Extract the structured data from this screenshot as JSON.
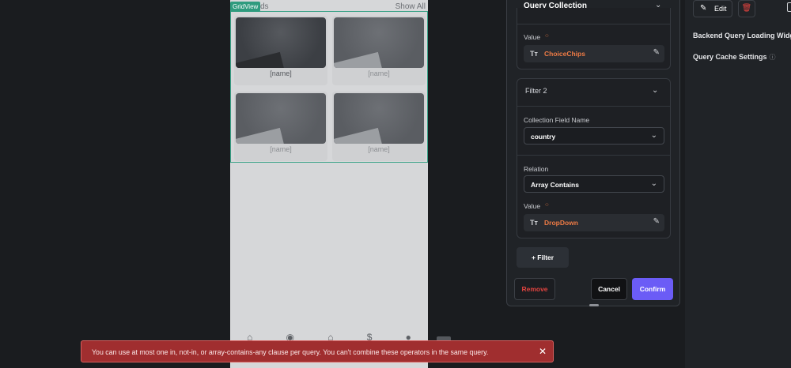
{
  "phone": {
    "title_partial": "ds",
    "show_all": "Show All",
    "gridview_badge": "GridView",
    "card_name": "[name]"
  },
  "query_panel": {
    "title": "Query Collection",
    "filter1": {
      "value_label": "Value",
      "value_text": "ChoiceChips"
    },
    "filter2": {
      "title": "Filter 2",
      "collection_field_label": "Collection Field Name",
      "collection_field_value": "country",
      "relation_label": "Relation",
      "relation_value": "Array Contains",
      "value_label": "Value",
      "value_text": "DropDown"
    },
    "add_filter_label": "Filter",
    "remove_label": "Remove",
    "cancel_label": "Cancel",
    "confirm_label": "Confirm"
  },
  "right_panel": {
    "edit_label": "Edit",
    "backend_query_loading": "Backend Query Loading Widge",
    "query_cache_settings": "Query Cache Settings"
  },
  "toast": {
    "message": "You can use at most one in, not-in, or array-contains-any clause per query. You can't combine these operators in the same query.",
    "close_symbol": "✕"
  },
  "colors": {
    "accent": "#6b5cf6",
    "error": "#a02e2f",
    "value_orange": "#ee7b45",
    "grid_green": "#2f9b7e"
  }
}
